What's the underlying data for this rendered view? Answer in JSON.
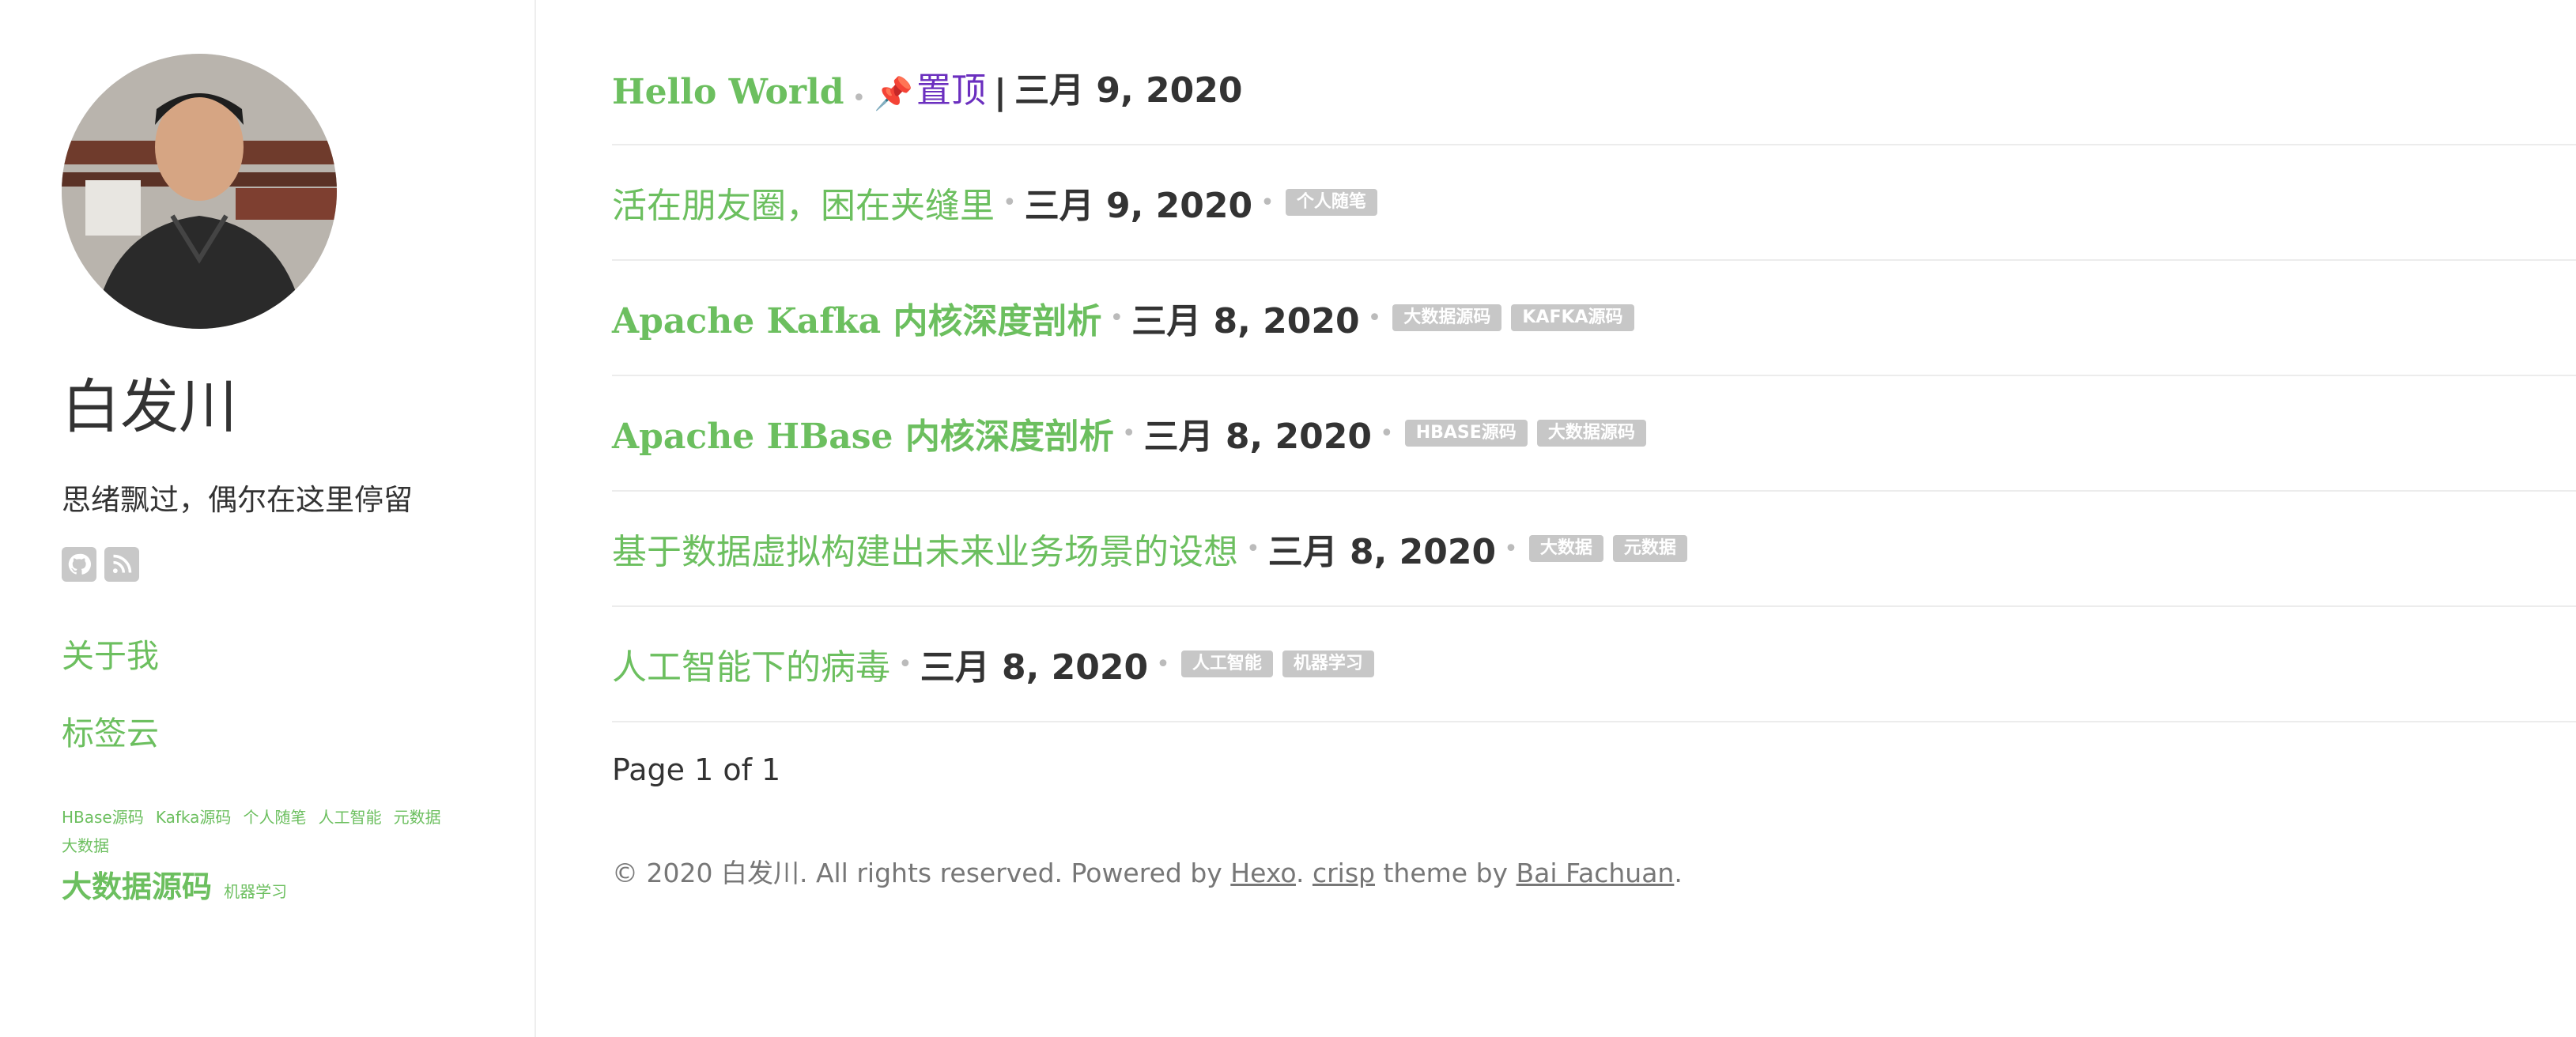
{
  "sidebar": {
    "title": "白发川",
    "description": "思绪飘过，偶尔在这里停留",
    "social": [
      {
        "icon": "github-icon"
      },
      {
        "icon": "rss-icon"
      }
    ],
    "nav": {
      "about": "关于我",
      "tagcloud": "标签云"
    },
    "tags": [
      {
        "label": "HBase源码",
        "size": "small"
      },
      {
        "label": "Kafka源码",
        "size": "small"
      },
      {
        "label": "个人随笔",
        "size": "small"
      },
      {
        "label": "人工智能",
        "size": "small"
      },
      {
        "label": "元数据",
        "size": "small"
      },
      {
        "label": "大数据",
        "size": "small"
      },
      {
        "label": "大数据源码",
        "size": "large"
      },
      {
        "label": "机器学习",
        "size": "small"
      }
    ]
  },
  "posts": [
    {
      "title": "Hello World",
      "pinned_label": "置顶",
      "bar": "|",
      "date": "三月 9, 2020",
      "tags": []
    },
    {
      "title": "活在朋友圈，困在夹缝里",
      "date": "三月 9, 2020",
      "tags": [
        "个人随笔"
      ]
    },
    {
      "title": "Apache Kafka 内核深度剖析",
      "date": "三月 8, 2020",
      "tags": [
        "大数据源码",
        "KAFKA源码"
      ]
    },
    {
      "title": "Apache HBase 内核深度剖析",
      "date": "三月 8, 2020",
      "tags": [
        "HBASE源码",
        "大数据源码"
      ]
    },
    {
      "title": "基于数据虚拟构建出未来业务场景的设想",
      "date": "三月 8, 2020",
      "tags": [
        "大数据",
        "元数据"
      ]
    },
    {
      "title": "人工智能下的病毒",
      "date": "三月 8, 2020",
      "tags": [
        "人工智能",
        "机器学习"
      ]
    }
  ],
  "separator": "•",
  "pagination": "Page 1 of 1",
  "footer": {
    "prefix": "© 2020 白发川. All rights reserved. Powered by ",
    "hexo": "Hexo",
    "dot": ". ",
    "crisp": "crisp",
    "middle": " theme by ",
    "author": "Bai Fachuan",
    "end": "."
  },
  "colors": {
    "accent": "#6cbf5f",
    "pinned": "#6b2fbf",
    "tag_bg": "#c7c7c7"
  }
}
